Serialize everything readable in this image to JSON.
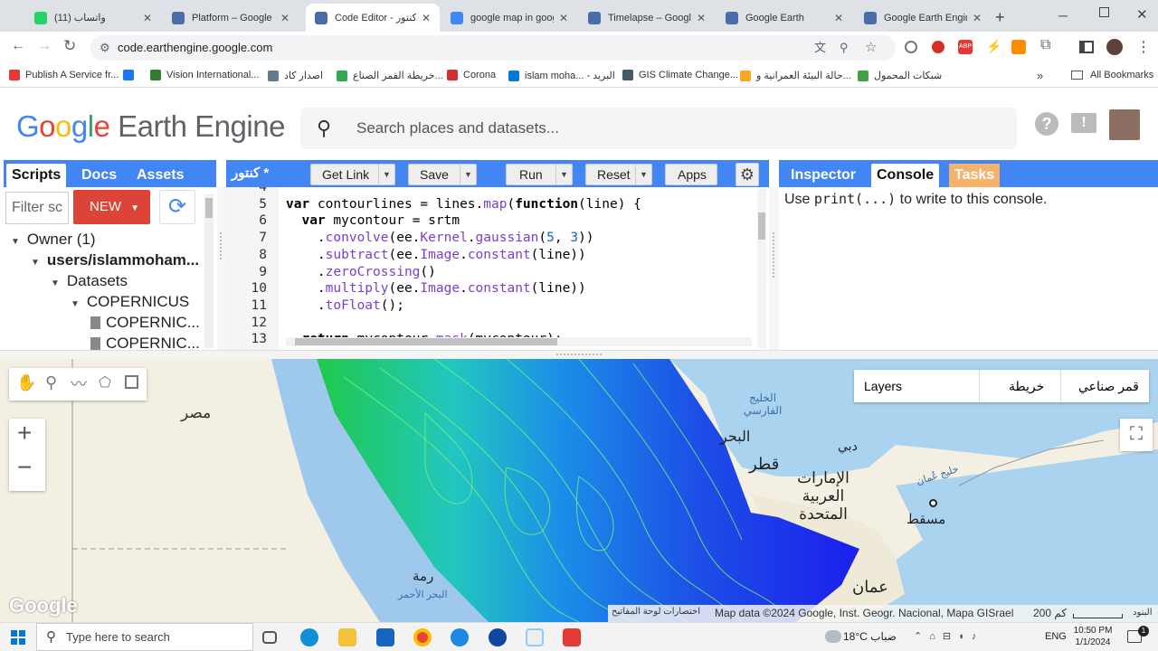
{
  "browser": {
    "tabs": [
      {
        "title": "(11) واتساب",
        "color": "#25d366"
      },
      {
        "title": "Platform – Google Ea",
        "color": "#4a6da7"
      },
      {
        "title": "Code Editor - كنتور*",
        "color": "#4a6da7",
        "active": true
      },
      {
        "title": "google map in goog",
        "color": "#4285f4"
      },
      {
        "title": "Timelapse – Google",
        "color": "#4a6da7"
      },
      {
        "title": "Google Earth",
        "color": "#4a6da7"
      },
      {
        "title": "Google Earth Engine",
        "color": "#4a6da7"
      }
    ],
    "new_tab": "+",
    "url": "code.earthengine.google.com",
    "bookmarks": [
      {
        "label": "Publish A Service fr...",
        "color": "#e53935"
      },
      {
        "label": "",
        "color": "#1877f2"
      },
      {
        "label": "Vision International...",
        "color": "#2e7d32"
      },
      {
        "label": "اصدار كاد",
        "color": "#607d8b"
      },
      {
        "label": "خريطة القمر الصناع...",
        "color": "#34a853"
      },
      {
        "label": "Corona",
        "color": "#d32f2f"
      },
      {
        "label": "islam moha... - البريد",
        "color": "#0078d4"
      },
      {
        "label": "GIS Climate Change...",
        "color": "#455a64"
      },
      {
        "label": "حالة البيئة العمرانية و...",
        "color": "#f9a825"
      },
      {
        "label": "شبكات المحمول",
        "color": "#43a047"
      }
    ],
    "all_bookmarks": "All Bookmarks"
  },
  "gee": {
    "logo_google": "Google",
    "logo_rest": " Earth Engine",
    "search_placeholder": "Search places and datasets..."
  },
  "left_panel": {
    "tabs": [
      "Scripts",
      "Docs",
      "Assets"
    ],
    "filter_placeholder": "Filter sc",
    "new_button": "NEW",
    "tree": [
      {
        "label": "Owner (1)",
        "level": 0,
        "type": "folder"
      },
      {
        "label": "users/islammoham...",
        "level": 1,
        "type": "folder"
      },
      {
        "label": "Datasets",
        "level": 2,
        "type": "folder"
      },
      {
        "label": "COPERNICUS",
        "level": 3,
        "type": "folder"
      },
      {
        "label": "COPERNIC...",
        "level": 4,
        "type": "file"
      },
      {
        "label": "COPERNIC...",
        "level": 4,
        "type": "file"
      }
    ]
  },
  "editor": {
    "script_name": "كنتور *",
    "buttons": [
      "Get Link",
      "Save",
      "Run",
      "Reset",
      "Apps"
    ],
    "lines": [
      {
        "n": "4",
        "code": ""
      },
      {
        "n": "5",
        "code": "var contourlines = lines.map(function(line) {"
      },
      {
        "n": "6",
        "code": "  var mycontour = srtm"
      },
      {
        "n": "7",
        "code": "    .convolve(ee.Kernel.gaussian(5, 3))"
      },
      {
        "n": "8",
        "code": "    .subtract(ee.Image.constant(line))"
      },
      {
        "n": "9",
        "code": "    .zeroCrossing()"
      },
      {
        "n": "10",
        "code": "    .multiply(ee.Image.constant(line))"
      },
      {
        "n": "11",
        "code": "    .toFloat();"
      },
      {
        "n": "12",
        "code": ""
      },
      {
        "n": "13",
        "code": "  return mycontour.mask(mycontour);"
      }
    ]
  },
  "right_panel": {
    "tabs": [
      "Inspector",
      "Console",
      "Tasks"
    ],
    "console_prefix": "Use ",
    "console_code": "print(...)",
    "console_suffix": " to write to this console."
  },
  "map": {
    "layers_label": "Layers",
    "map_type": "خريطة",
    "satellite": "قمر صناعي",
    "labels": [
      "مصر",
      "الخليج الفارسي",
      "البحر",
      "قطر",
      "دبي",
      "الإمارات العربية المتحدة",
      "مسقط",
      "خليج عُمان",
      "عمان",
      "رمة",
      "البحر الأحمر"
    ],
    "attribution": "Map data ©2024 Google, Inst. Geogr. Nacional, Mapa GISrael",
    "shortcuts": "اختصارات لوحة المفاتيح",
    "scale": "200 كم",
    "terms": "البنود",
    "google_watermark": "Google"
  },
  "taskbar": {
    "search_placeholder": "Type here to search",
    "weather": "18°C ضباب",
    "lang": "ENG",
    "time": "10:50 PM",
    "date": "1/1/2024",
    "notification_count": "1"
  }
}
